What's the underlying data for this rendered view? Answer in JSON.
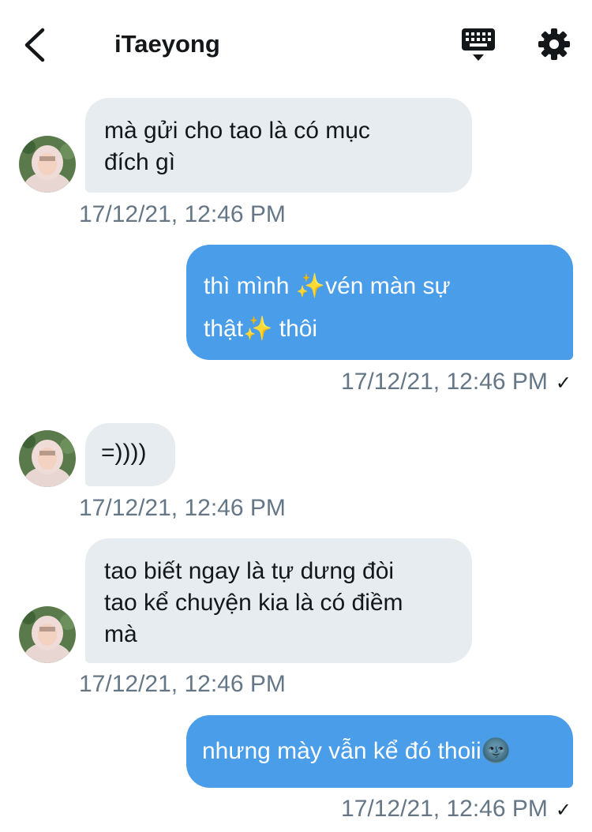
{
  "header": {
    "title": "iTaeyong"
  },
  "messages": [
    {
      "direction": "in",
      "text": "mà gửi cho tao là có mục\nđích gì",
      "time": "17/12/21, 12:46 PM"
    },
    {
      "direction": "out",
      "text": "thì mình ✨vén màn sự\nthật✨ thôi",
      "time": "17/12/21, 12:46 PM",
      "status": "✓"
    },
    {
      "direction": "in",
      "text": "=))))",
      "time": "17/12/21, 12:46 PM"
    },
    {
      "direction": "in",
      "text": "tao biết ngay là tự dưng đòi\ntao kể chuyện kia là có điềm\nmà",
      "time": "17/12/21, 12:46 PM"
    },
    {
      "direction": "out",
      "text": "nhưng mày vẫn kể đó thoii🌚",
      "time": "17/12/21, 12:46 PM",
      "status": "✓"
    }
  ],
  "colors": {
    "incoming_bubble": "#e6ecf0",
    "outgoing_bubble": "#4a9de9",
    "timestamp": "#657786"
  },
  "icons": {
    "back": "chevron-left-icon",
    "keyboard": "keyboard-icon",
    "settings": "gear-icon",
    "read": "checkmark-icon"
  }
}
